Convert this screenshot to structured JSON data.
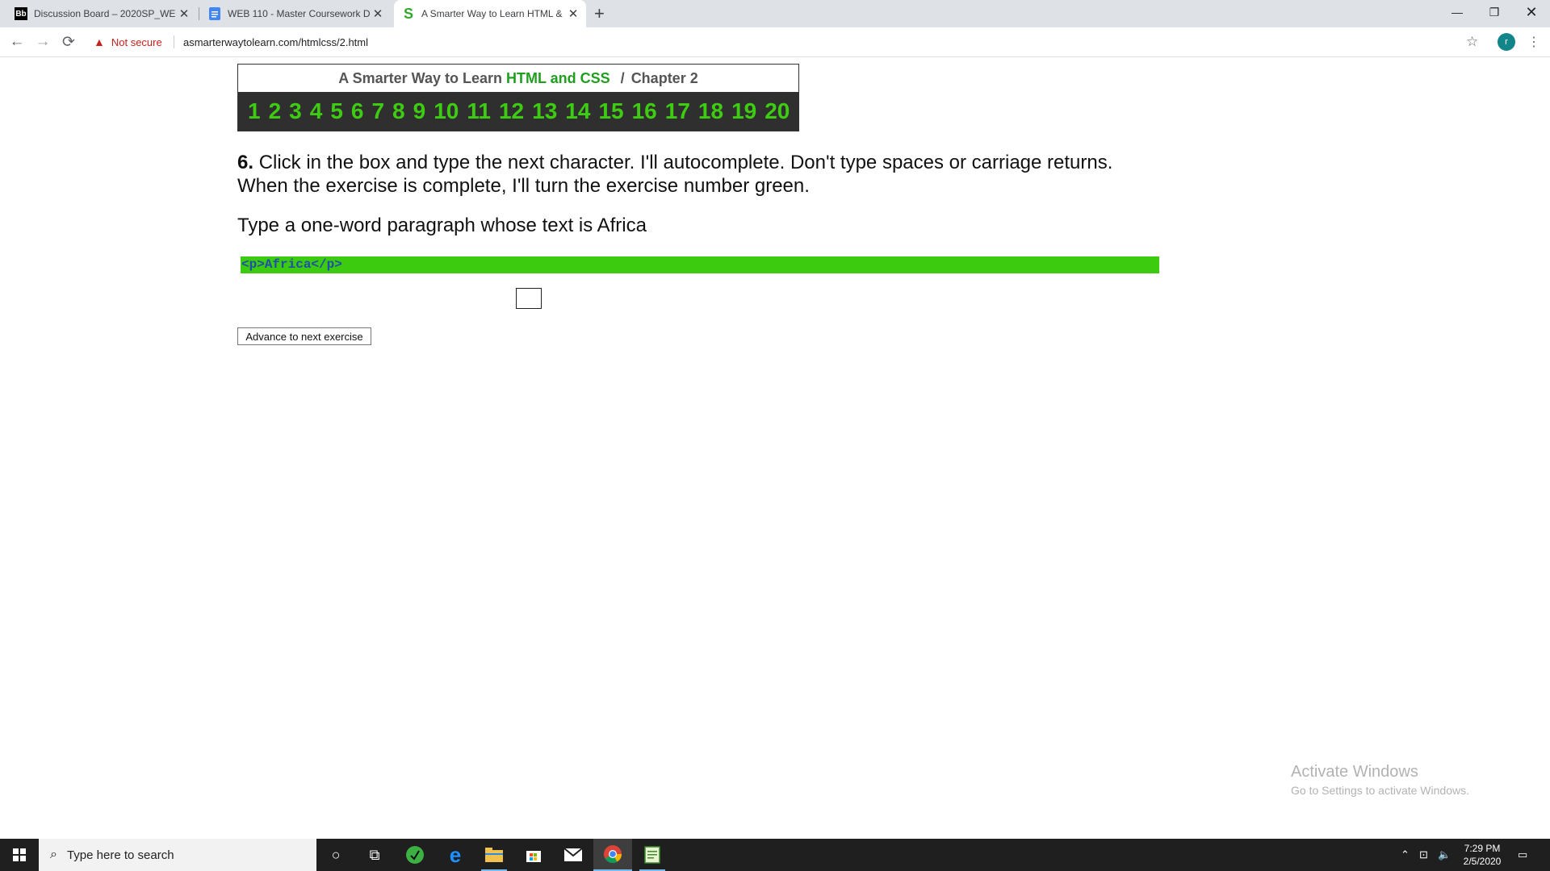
{
  "browser": {
    "tabs": [
      {
        "favicon": "Bb",
        "title": "Discussion Board – 2020SP_WEB",
        "active": false
      },
      {
        "favicon": "doc-icon",
        "title": "WEB 110 - Master Coursework D",
        "active": false
      },
      {
        "favicon": "S",
        "title": "A Smarter Way to Learn HTML &",
        "active": true
      }
    ],
    "new_tab": "+",
    "security_text": "Not secure",
    "url": "asmarterwaytolearn.com/htmlcss/2.html",
    "profile_initial": "r"
  },
  "page": {
    "header": {
      "prefix": "A Smarter Way to Learn",
      "highlight": "HTML and CSS",
      "slash": "/",
      "chapter": "Chapter 2"
    },
    "exercise_numbers": [
      "1",
      "2",
      "3",
      "4",
      "5",
      "6",
      "7",
      "8",
      "9",
      "10",
      "11",
      "12",
      "13",
      "14",
      "15",
      "16",
      "17",
      "18",
      "19",
      "20"
    ],
    "instruction_number": "6.",
    "instruction_text": "Click in the box and type the next character. I'll autocomplete. Don't type spaces or carriage returns. When the exercise is complete, I'll turn the exercise number green.",
    "prompt": "Type a one-word paragraph whose text is Africa",
    "answer": "<p>Africa</p>",
    "advance_button": "Advance to next exercise"
  },
  "watermark": {
    "line1": "Activate Windows",
    "line2": "Go to Settings to activate Windows."
  },
  "taskbar": {
    "search_placeholder": "Type here to search",
    "time": "7:29 PM",
    "date": "2/5/2020"
  },
  "colors": {
    "accent_green": "#3ecc12",
    "answer_bar": "#3ccb0e",
    "chapter_highlight": "#209f1f",
    "not_secure_red": "#c5221f"
  }
}
